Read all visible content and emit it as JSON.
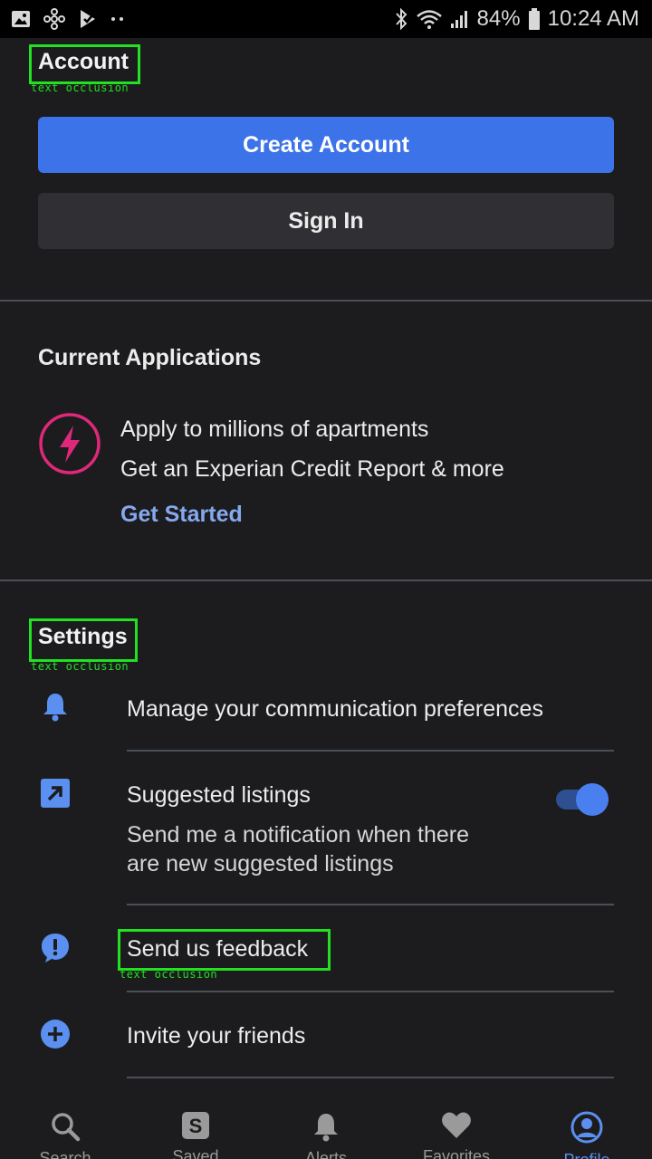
{
  "status_bar": {
    "battery": "84%",
    "time": "10:24 AM"
  },
  "account": {
    "title": "Account",
    "annotation": "text occlusion",
    "create_label": "Create Account",
    "signin_label": "Sign In"
  },
  "applications": {
    "title": "Current Applications",
    "line1": "Apply to millions of apartments",
    "line2": "Get an Experian Credit Report & more",
    "cta": "Get Started"
  },
  "settings": {
    "title": "Settings",
    "annotation": "text occlusion",
    "items": [
      {
        "label": "Manage your communication preferences",
        "icon": "bell-icon"
      },
      {
        "label": "Suggested listings",
        "description_line1": "Send me a notification when there",
        "description_line2": "are new suggested listings",
        "icon": "arrow-up-right-icon",
        "toggle_on": true
      },
      {
        "label": "Send us feedback",
        "icon": "exclamation-bubble-icon",
        "annotation": "text occlusion"
      },
      {
        "label": "Invite your friends",
        "icon": "plus-circle-icon"
      }
    ]
  },
  "tabs": [
    {
      "label": "Search",
      "icon": "search-icon"
    },
    {
      "label": "Saved",
      "icon": "saved-s-icon"
    },
    {
      "label": "Alerts",
      "icon": "bell-icon"
    },
    {
      "label": "Favorites",
      "icon": "heart-icon"
    },
    {
      "label": "Profile",
      "icon": "profile-icon",
      "active": true
    }
  ],
  "colors": {
    "accent": "#3d73e8",
    "link": "#86a8ee",
    "lightning": "#e0287a",
    "background": "#1c1c1e",
    "annotation": "#22e022"
  }
}
